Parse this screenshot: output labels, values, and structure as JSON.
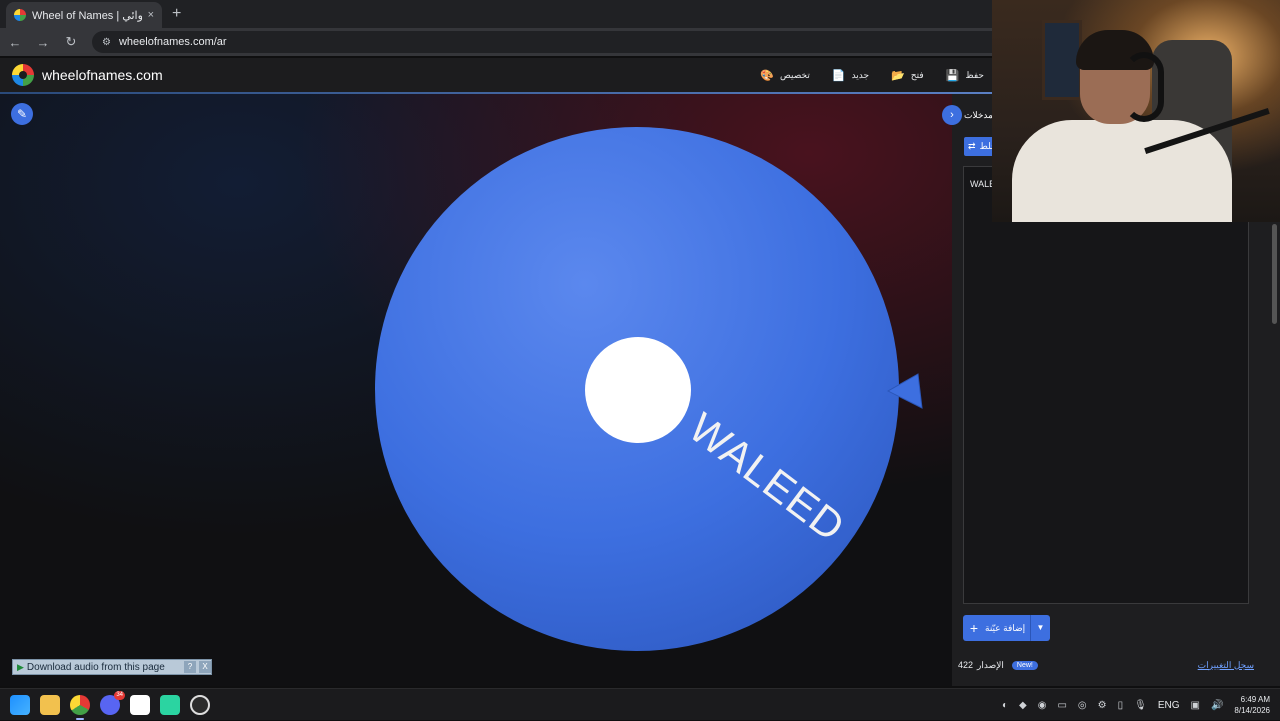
{
  "browser": {
    "tab_title": "Wheel of Names | اسم العشوائي",
    "tab_close": "×",
    "new_tab": "+",
    "url": "wheelofnames.com/ar",
    "back": "←",
    "forward": "→",
    "reload": "↻",
    "site_settings": "⚙"
  },
  "site": {
    "logo_text": "wheelofnames.com",
    "actions": [
      {
        "label": "حفظ",
        "icon": "save-icon",
        "glyph": "💾"
      },
      {
        "label": "فتح",
        "icon": "folder-open-icon",
        "glyph": "📂"
      },
      {
        "label": "جديد",
        "icon": "new-file-icon",
        "glyph": "📄"
      },
      {
        "label": "تخصيص",
        "icon": "palette-icon",
        "glyph": "🎨"
      }
    ]
  },
  "wheel": {
    "entry_label": "WALEED",
    "color": "#3d6fe0",
    "edit_glyph": "✎"
  },
  "panel": {
    "tab_label": "مدخلات",
    "collapse_glyph": "›",
    "shuffle_glyph": "⇄",
    "shuffle_label": "خلط",
    "entries": [
      "WALEED"
    ],
    "add_button": "إضافة عيّنة",
    "add_plus": "+",
    "add_caret": "▼",
    "version_label": "الإصدار",
    "version_number": "422",
    "new_badge": "New!",
    "changelog": "سجل التغييرات"
  },
  "audio_bar": {
    "play": "▶",
    "label": "Download audio from this page",
    "help": "?",
    "close": "X"
  },
  "taskbar": {
    "discord_badge": "34",
    "language": "ENG",
    "time": "6:49 AM",
    "date": "8/14/2026"
  },
  "colors": {
    "accent": "#3d6fe0",
    "panel_bg": "#1e1e20",
    "header_bg": "#1c1c1e"
  }
}
